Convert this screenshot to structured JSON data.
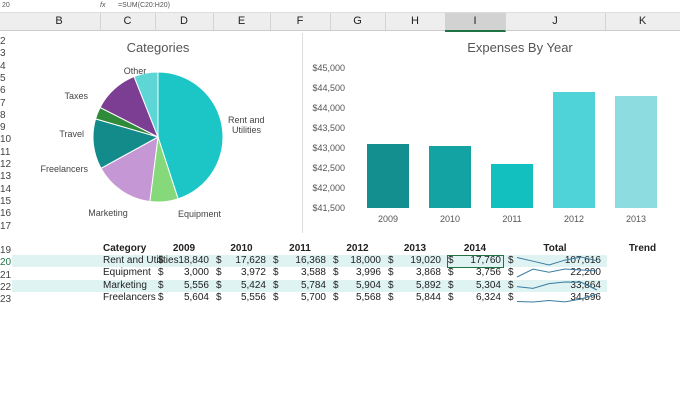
{
  "formula_bar": {
    "name_box": "20",
    "formula": "=SUM(C20:H20)",
    "fx": "fx"
  },
  "columns": [
    "B",
    "C",
    "D",
    "E",
    "F",
    "G",
    "H",
    "I",
    "J",
    "K"
  ],
  "row_numbers": [
    "2",
    "3",
    "4",
    "5",
    "6",
    "7",
    "8",
    "9",
    "10",
    "11",
    "12",
    "13",
    "14",
    "15",
    "16",
    "17",
    "",
    "19",
    "20",
    "21",
    "22",
    "23"
  ],
  "colors": {
    "teal": "#00c1c1",
    "accent": "#217346"
  },
  "chart_data": [
    {
      "type": "pie",
      "title": "Categories",
      "slices": [
        {
          "label": "Rent and Utilities",
          "value": 45,
          "color": "#1cc6c6"
        },
        {
          "label": "Equipment",
          "value": 7,
          "color": "#86d97a"
        },
        {
          "label": "Marketing",
          "value": 15,
          "color": "#c597d4"
        },
        {
          "label": "Freelancers",
          "value": 12.5,
          "color": "#148b8b"
        },
        {
          "label": "Travel",
          "value": 3,
          "color": "#2f8a3a"
        },
        {
          "label": "Taxes",
          "value": 11.5,
          "color": "#7c3e92"
        },
        {
          "label": "Other",
          "value": 6,
          "color": "#5fd6d6"
        }
      ]
    },
    {
      "type": "bar",
      "title": "Expenses By Year",
      "categories": [
        "2009",
        "2010",
        "2011",
        "2012",
        "2013"
      ],
      "values": [
        43100,
        43050,
        42600,
        44400,
        44300
      ],
      "colors": [
        "#138f8f",
        "#14a3a3",
        "#12c0c0",
        "#4fd3d8",
        "#8ddde0"
      ],
      "ylim": [
        41500,
        45000
      ],
      "yticks": [
        "$41,500",
        "$42,000",
        "$42,500",
        "$43,000",
        "$43,500",
        "$44,000",
        "$44,500",
        "$45,000"
      ]
    }
  ],
  "table": {
    "headers": [
      "Category",
      "2009",
      "2010",
      "2011",
      "2012",
      "2013",
      "2014",
      "Total",
      "Trend"
    ],
    "rows": [
      {
        "cells": [
          "Rent and Utilities",
          "18,840",
          "17,628",
          "16,368",
          "18,000",
          "19,020",
          "17,760",
          "107,616"
        ],
        "trend": [
          18840,
          17628,
          16368,
          18000,
          19020,
          17760
        ]
      },
      {
        "cells": [
          "Equipment",
          "3,000",
          "3,972",
          "3,588",
          "3,996",
          "3,868",
          "3,756",
          "22,200"
        ],
        "trend": [
          3000,
          3972,
          3588,
          3996,
          3868,
          3756
        ]
      },
      {
        "cells": [
          "Marketing",
          "5,556",
          "5,424",
          "5,784",
          "5,904",
          "5,892",
          "5,304",
          "33,864"
        ],
        "trend": [
          5556,
          5424,
          5784,
          5904,
          5892,
          5304
        ]
      },
      {
        "cells": [
          "Freelancers",
          "5,604",
          "5,556",
          "5,700",
          "5,568",
          "5,844",
          "6,324",
          "34,596"
        ],
        "trend": [
          5604,
          5556,
          5700,
          5568,
          5844,
          6324
        ]
      }
    ],
    "currency": "$"
  }
}
